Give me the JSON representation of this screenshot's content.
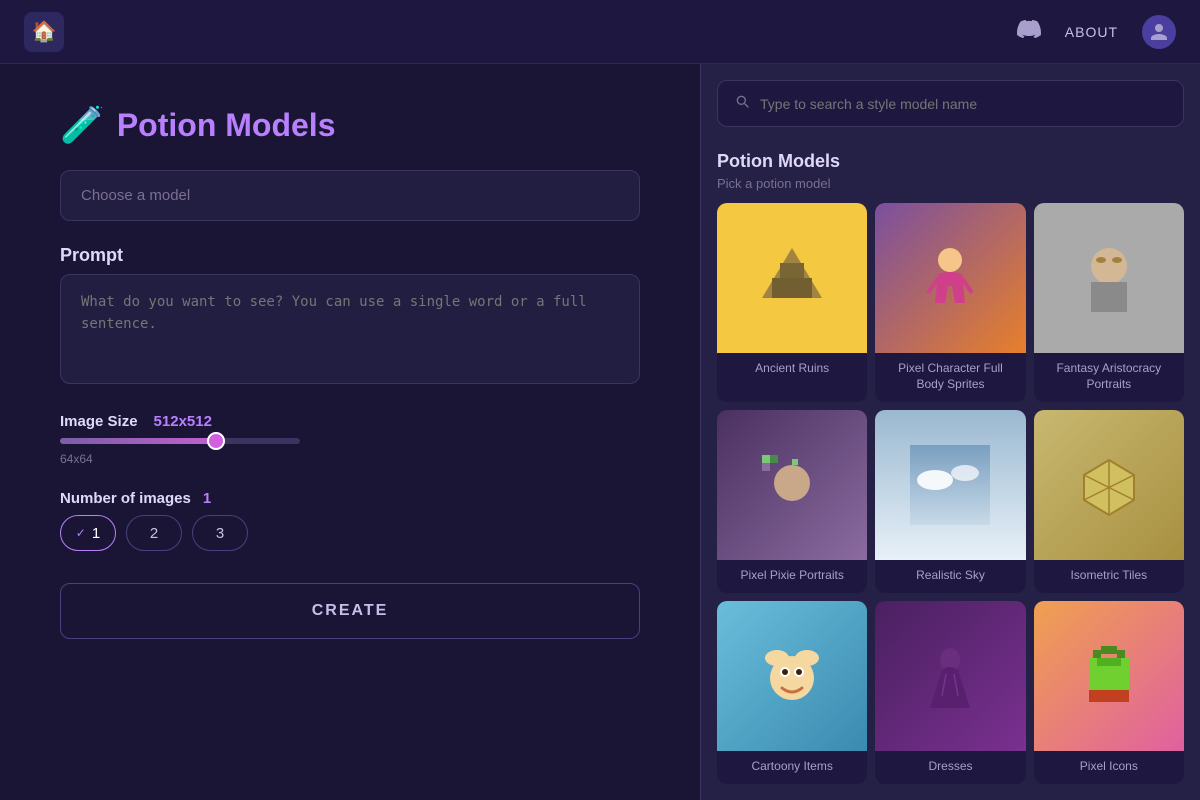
{
  "navbar": {
    "logo_icon": "🏠",
    "about_label": "ABOUT",
    "discord_icon": "⊙",
    "user_icon": "👤"
  },
  "left": {
    "page_title": "Potion Models",
    "potion_icon": "🧪",
    "model_placeholder": "Choose a model",
    "prompt_section_label": "Prompt",
    "prompt_placeholder": "What do you want to see? You can use a single word or a full sentence.",
    "image_size_label": "Image Size",
    "image_size_value": "512x512",
    "slider_min_label": "64x64",
    "num_images_label": "Number of images",
    "num_images_value": "1",
    "num_options": [
      "1",
      "2",
      "3"
    ],
    "create_label": "CREATE"
  },
  "right_panel": {
    "search_placeholder": "Type to search a style model name",
    "panel_title": "Potion Models",
    "panel_subtitle": "Pick a potion model",
    "models": [
      {
        "name": "Ancient Ruins",
        "bg": "bg-ancient",
        "icon": "🏛️"
      },
      {
        "name": "Pixel Character Full Body Sprites",
        "bg": "bg-pixel-char",
        "icon": "🧝"
      },
      {
        "name": "Fantasy Aristocracy Portraits",
        "bg": "bg-fantasy",
        "icon": "🧝‍♀️"
      },
      {
        "name": "Pixel Pixie Portraits",
        "bg": "bg-pixie",
        "icon": "🧚"
      },
      {
        "name": "Realistic Sky",
        "bg": "bg-sky",
        "icon": "☁️"
      },
      {
        "name": "Isometric Tiles",
        "bg": "bg-isometric",
        "icon": "🎲"
      },
      {
        "name": "Cartoony Items",
        "bg": "bg-cartoony",
        "icon": "🐰"
      },
      {
        "name": "Dresses",
        "bg": "bg-dresses",
        "icon": "👗"
      },
      {
        "name": "Pixel Icons",
        "bg": "bg-pixel-icons",
        "icon": "🍎"
      }
    ]
  }
}
